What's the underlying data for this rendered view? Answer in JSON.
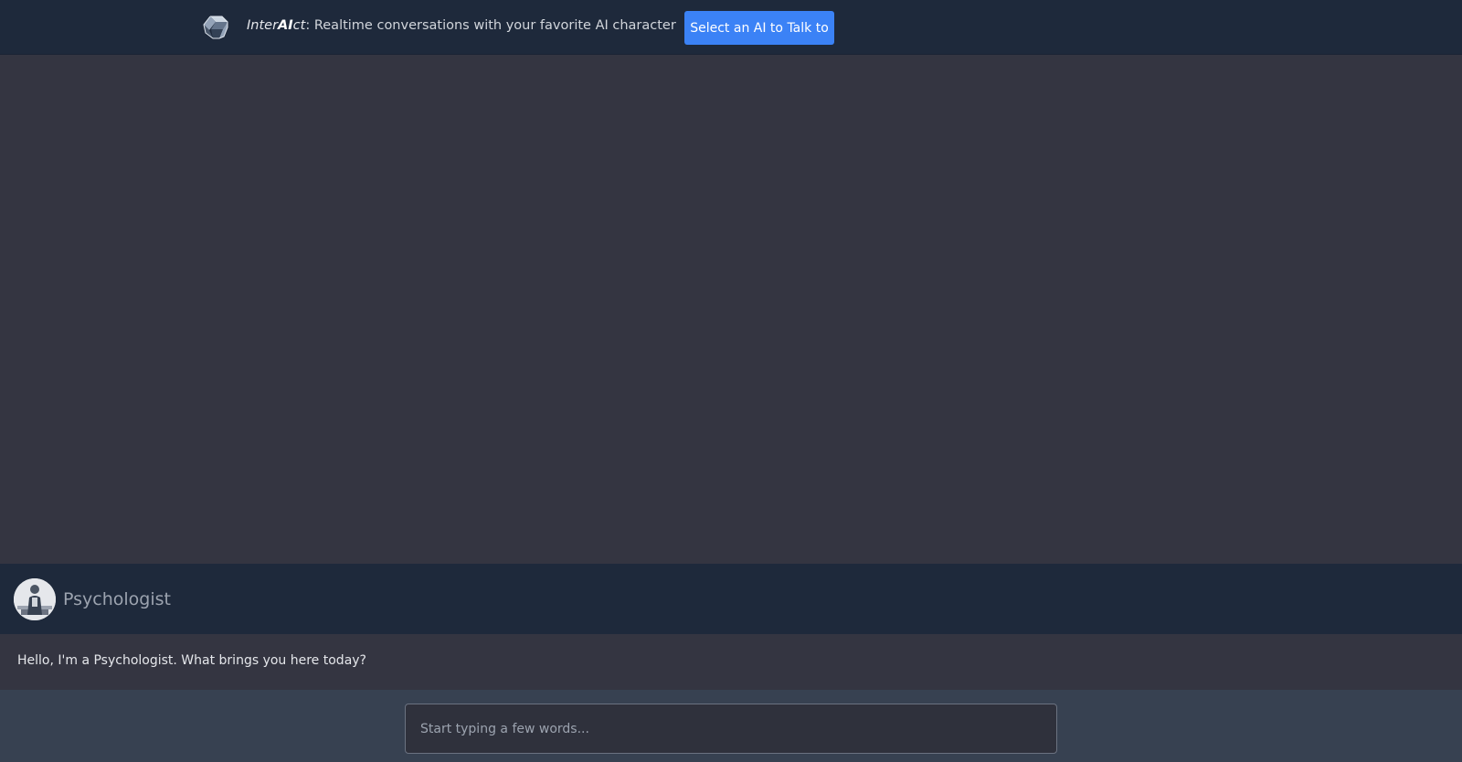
{
  "header": {
    "brand_prefix": "Inter",
    "brand_ai": "AI",
    "brand_suffix": "ct",
    "tagline": ": Realtime conversations with your favorite AI character",
    "select_button_label": "Select an AI to Talk to",
    "logo_icon": "cube-icon",
    "accent_color": "#3b82f6"
  },
  "character": {
    "name": "Psychologist",
    "avatar_icon": "person-avatar"
  },
  "messages": [
    {
      "text": "Hello, I'm a Psychologist. What brings you here today?"
    }
  ],
  "composer": {
    "value": "",
    "placeholder": "Start typing a few words..."
  }
}
